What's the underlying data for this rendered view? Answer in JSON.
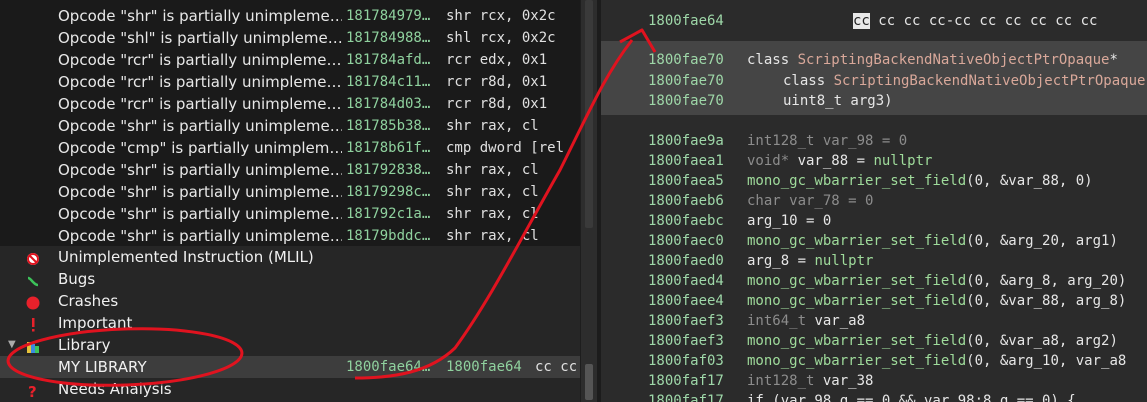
{
  "issues": [
    {
      "msg": "Opcode \"shr\" is partially unimpleme…",
      "addr": "181784979…",
      "ins": "shr rcx, 0x2c"
    },
    {
      "msg": "Opcode \"shl\" is partially unimpleme…",
      "addr": "181784988…",
      "ins": "shl rcx, 0x2c"
    },
    {
      "msg": "Opcode \"rcr\" is partially unimpleme…",
      "addr": "181784afd…",
      "ins": "rcr edx, 0x1"
    },
    {
      "msg": "Opcode \"rcr\" is partially unimpleme…",
      "addr": "181784c11…",
      "ins": "rcr r8d, 0x1"
    },
    {
      "msg": "Opcode \"rcr\" is partially unimpleme…",
      "addr": "181784d03…",
      "ins": "rcr r8d, 0x1"
    },
    {
      "msg": "Opcode \"shr\" is partially unimpleme…",
      "addr": "181785b38…",
      "ins": "shr rax, cl"
    },
    {
      "msg": "Opcode \"cmp\" is partially unimplem…",
      "addr": "18178b61f…",
      "ins": "cmp dword [rel"
    },
    {
      "msg": "Opcode \"shr\" is partially unimpleme…",
      "addr": "181792838…",
      "ins": "shr rax, cl"
    },
    {
      "msg": "Opcode \"shr\" is partially unimpleme…",
      "addr": "18179298c…",
      "ins": "shr rax, cl"
    },
    {
      "msg": "Opcode \"shr\" is partially unimpleme…",
      "addr": "181792c1a…",
      "ins": "shr rax, cl"
    },
    {
      "msg": "Opcode \"shr\" is partially unimpleme…",
      "addr": "18179bddc…",
      "ins": "shr rax, cl"
    }
  ],
  "categories": {
    "unimplemented": "Unimplemented Instruction (MLIL)",
    "bugs": "Bugs",
    "crashes": "Crashes",
    "important": "Important",
    "library": "Library",
    "needs_analysis": "Needs Analysis"
  },
  "selected_row": {
    "label": "MY LIBRARY",
    "addr1": "1800fae64…",
    "addr2": "1800fae64",
    "bytes": "cc cc"
  },
  "code": {
    "top_addr": "1800fae64",
    "top_bytes_sel": "cc",
    "top_bytes": " cc cc cc-cc cc cc cc cc cc",
    "sig_addrs": [
      "1800fae70",
      "1800fae70",
      "1800fae70"
    ],
    "sig_l1_kw": "class ",
    "sig_l1_type": "ScriptingBackendNativeObjectPtrOpaque",
    "sig_l1_tail": "*",
    "sig_l2_kw": "class ",
    "sig_l2_type": "ScriptingBackendNativeObjectPtrOpaque",
    "sig_l3": "uint8_t arg3)",
    "lines": [
      {
        "addr": "1800fae9a",
        "parts": [
          {
            "c": "dim",
            "t": "int128_t var_98 = 0"
          }
        ]
      },
      {
        "addr": "1800faea1",
        "parts": [
          {
            "c": "dim",
            "t": "void* "
          },
          {
            "c": "k",
            "t": "var_88 = "
          },
          {
            "c": "const",
            "t": "nullptr"
          }
        ]
      },
      {
        "addr": "1800faea5",
        "parts": [
          {
            "c": "fn",
            "t": "mono_gc_wbarrier_set_field"
          },
          {
            "c": "k",
            "t": "(0, &var_88, 0)"
          }
        ]
      },
      {
        "addr": "1800faeb6",
        "parts": [
          {
            "c": "dim",
            "t": "char var_78 = 0"
          }
        ]
      },
      {
        "addr": "1800faebc",
        "parts": [
          {
            "c": "k",
            "t": "arg_10 = 0"
          }
        ]
      },
      {
        "addr": "1800faec0",
        "parts": [
          {
            "c": "fn",
            "t": "mono_gc_wbarrier_set_field"
          },
          {
            "c": "k",
            "t": "(0, &arg_20, arg1)"
          }
        ]
      },
      {
        "addr": "1800faed0",
        "parts": [
          {
            "c": "k",
            "t": "arg_8 = "
          },
          {
            "c": "const",
            "t": "nullptr"
          }
        ]
      },
      {
        "addr": "1800faed4",
        "parts": [
          {
            "c": "fn",
            "t": "mono_gc_wbarrier_set_field"
          },
          {
            "c": "k",
            "t": "(0, &arg_8, arg_20)"
          }
        ]
      },
      {
        "addr": "1800faee4",
        "parts": [
          {
            "c": "fn",
            "t": "mono_gc_wbarrier_set_field"
          },
          {
            "c": "k",
            "t": "(0, &var_88, arg_8)"
          }
        ]
      },
      {
        "addr": "1800faef3",
        "parts": [
          {
            "c": "dim",
            "t": "int64_t "
          },
          {
            "c": "k",
            "t": "var_a8"
          }
        ]
      },
      {
        "addr": "1800faef3",
        "parts": [
          {
            "c": "fn",
            "t": "mono_gc_wbarrier_set_field"
          },
          {
            "c": "k",
            "t": "(0, &var_a8, arg2)"
          }
        ]
      },
      {
        "addr": "1800faf03",
        "parts": [
          {
            "c": "fn",
            "t": "mono_gc_wbarrier_set_field"
          },
          {
            "c": "k",
            "t": "(0, &arg_10, var_a8"
          }
        ]
      },
      {
        "addr": "1800faf17",
        "parts": [
          {
            "c": "dim",
            "t": "int128_t "
          },
          {
            "c": "k",
            "t": "var_38"
          }
        ]
      },
      {
        "addr": "1800faf17",
        "parts": [
          {
            "c": "k",
            "t": "if (var_98.q == 0 && var_98:8.q == 0) {"
          }
        ]
      }
    ]
  },
  "colors": {
    "accent_green": "#8fd19e",
    "annotation_red": "#e0131f",
    "bg": "#262626"
  }
}
